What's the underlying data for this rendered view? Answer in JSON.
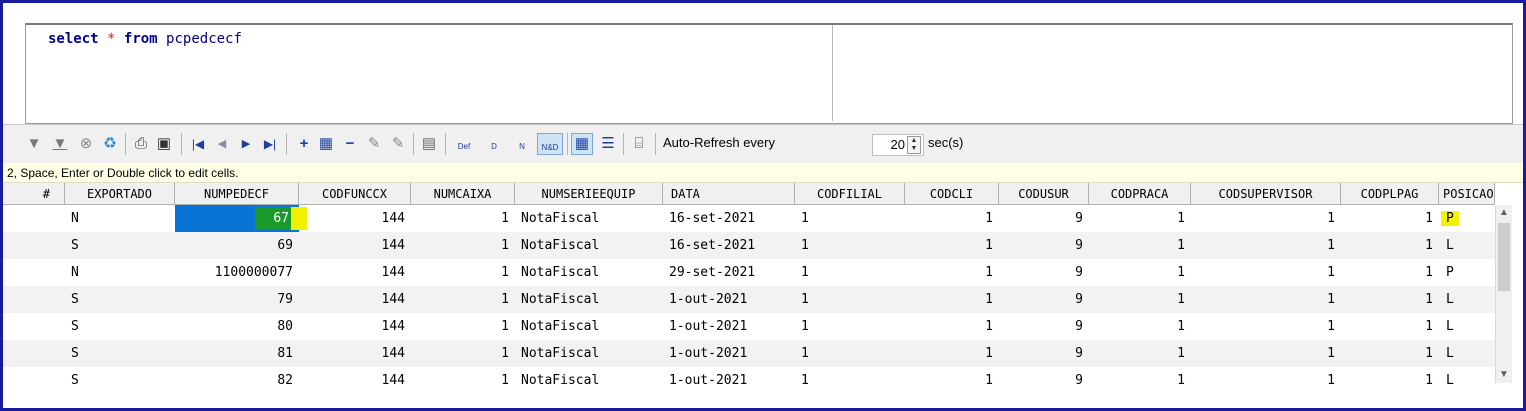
{
  "editor": {
    "kw_select": "select",
    "star": "*",
    "kw_from": "from",
    "table": "pcpedcecf"
  },
  "toolbar": {
    "auto_refresh_label": "Auto-Refresh every",
    "interval": "20",
    "unit": "sec(s)",
    "icons": [
      "filter-icon",
      "filter-clear-icon",
      "cancel-icon",
      "refresh-icon",
      "print-icon",
      "save-icon",
      "first-record-icon",
      "prev-record-icon",
      "next-record-icon",
      "last-record-icon",
      "insert-record-icon",
      "insert-multi-icon",
      "delete-record-icon",
      "post-edit-icon",
      "cancel-edit-icon",
      "form-view-icon",
      "def-icon",
      "d-icon",
      "n-icon",
      "nd-icon",
      "grid-view-icon",
      "tree-view-icon",
      "auto-refresh-icon"
    ],
    "labels": {
      "def": "Def",
      "d": "D",
      "n": "N",
      "nd": "N&D"
    }
  },
  "hint": "2, Space, Enter or Double click to edit cells.",
  "grid": {
    "columns": [
      "#",
      "EXPORTADO",
      "NUMPEDECF",
      "CODFUNCCX",
      "NUMCAIXA",
      "NUMSERIEEQUIP",
      "DATA",
      "CODFILIAL",
      "CODCLI",
      "CODUSUR",
      "CODPRACA",
      "CODSUPERVISOR",
      "CODPLPAG",
      "POSICAO"
    ],
    "rows": [
      [
        "N",
        "67",
        "144",
        "1",
        "NotaFiscal",
        "16-set-2021",
        "1",
        "1",
        "9",
        "1",
        "1",
        "1",
        "P"
      ],
      [
        "S",
        "69",
        "144",
        "1",
        "NotaFiscal",
        "16-set-2021",
        "1",
        "1",
        "9",
        "1",
        "1",
        "1",
        "L"
      ],
      [
        "N",
        "1100000077",
        "144",
        "1",
        "NotaFiscal",
        "29-set-2021",
        "1",
        "1",
        "9",
        "1",
        "1",
        "1",
        "P"
      ],
      [
        "S",
        "79",
        "144",
        "1",
        "NotaFiscal",
        "1-out-2021",
        "1",
        "1",
        "9",
        "1",
        "1",
        "1",
        "L"
      ],
      [
        "S",
        "80",
        "144",
        "1",
        "NotaFiscal",
        "1-out-2021",
        "1",
        "1",
        "9",
        "1",
        "1",
        "1",
        "L"
      ],
      [
        "S",
        "81",
        "144",
        "1",
        "NotaFiscal",
        "1-out-2021",
        "1",
        "1",
        "9",
        "1",
        "1",
        "1",
        "L"
      ],
      [
        "S",
        "82",
        "144",
        "1",
        "NotaFiscal",
        "1-out-2021",
        "1",
        "1",
        "9",
        "1",
        "1",
        "1",
        "L"
      ]
    ]
  },
  "colors": {
    "selection": "#0a74d6",
    "active_cell": "#1a9a2a",
    "highlight": "#f4f400",
    "frame": "#1a1aa0"
  }
}
